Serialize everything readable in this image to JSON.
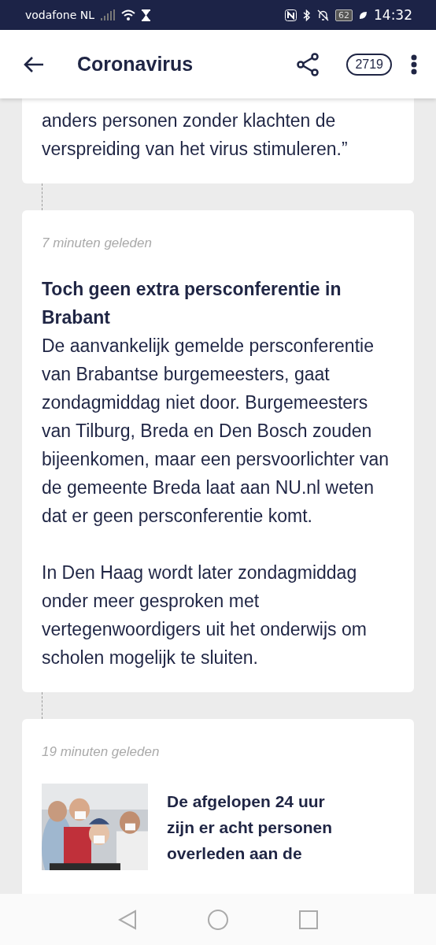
{
  "status_bar": {
    "carrier": "vodafone NL",
    "battery": "62",
    "time": "14:32"
  },
  "header": {
    "title": "Coronavirus",
    "comment_count": "2719"
  },
  "posts": [
    {
      "kind": "text",
      "paragraphs": [
        "anders personen zonder klachten de verspreiding van het virus stimuleren.”"
      ]
    },
    {
      "kind": "text",
      "time": "7 minuten geleden",
      "headline": "Toch geen extra persconferentie in Brabant",
      "paragraphs": [
        "De aanvankelijk gemelde persconferentie van Brabantse burgemeesters, gaat zondagmiddag niet door. Burgemeesters van Tilburg, Breda en Den Bosch zouden bijeenkomen, maar een persvoorlichter van de gemeente Breda laat aan NU.nl weten dat er geen persconferentie komt.",
        "In Den Haag wordt later zondagmiddag onder meer gesproken met vertegenwoordigers uit het onderwijs om scholen mogelijk te sluiten."
      ]
    },
    {
      "time": "19 minuten geleden",
      "headline": "De afgelopen 24 uur zijn er acht personen overleden aan de"
    }
  ]
}
